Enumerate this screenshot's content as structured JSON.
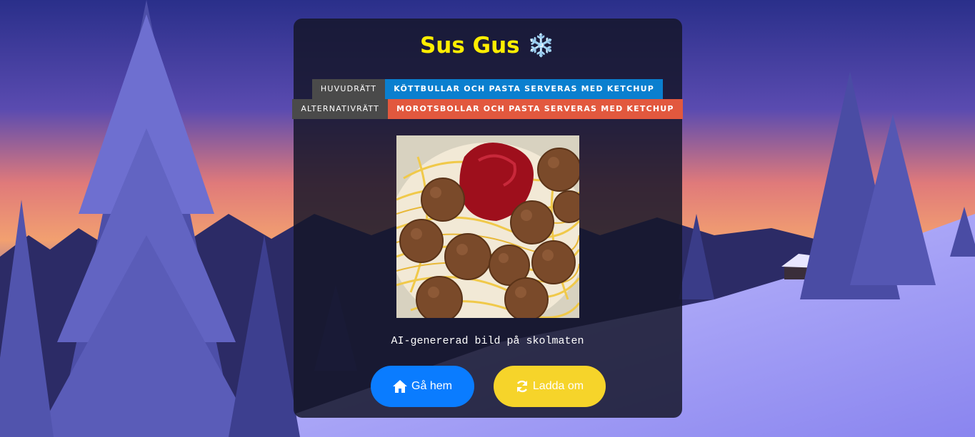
{
  "header": {
    "title": "Sus Gus",
    "title_emoji": "❄️"
  },
  "menu": {
    "main": {
      "label": "HUVUDRÄTT",
      "dish": "KÖTTBULLAR OCH PASTA SERVERAS MED KETCHUP",
      "color": "#0a7fcf"
    },
    "alternative": {
      "label": "ALTERNATIVRÄTT",
      "dish": "MOROTSBOLLAR OCH PASTA SERVERAS MED KETCHUP",
      "color": "#e2583e"
    }
  },
  "image": {
    "caption": "AI-genererad bild på skolmaten"
  },
  "buttons": {
    "home": {
      "label": "Gå hem",
      "icon": "home-icon",
      "color": "#0a7cff"
    },
    "reload": {
      "label": "Ladda om",
      "icon": "refresh-icon",
      "color": "#f6d42a"
    }
  },
  "colors": {
    "title": "#ffee00",
    "card_bg": "rgba(20,22,40,0.84)"
  }
}
